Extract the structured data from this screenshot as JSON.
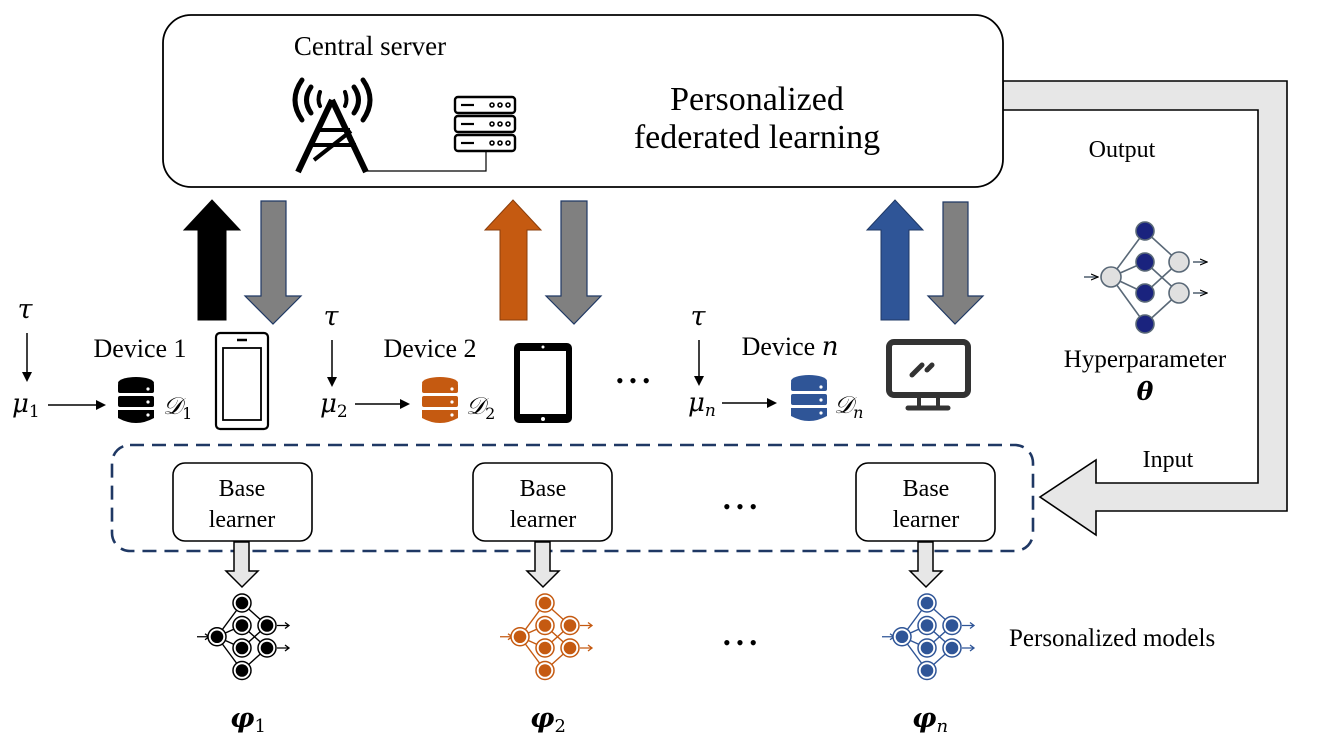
{
  "server": {
    "title": "Central server",
    "label_line1": "Personalized",
    "label_line2": "federated learning",
    "tower_icon": "radio-tower-icon",
    "rack_icon": "server-rack-icon"
  },
  "feedback": {
    "output_label": "Output",
    "input_label": "Input",
    "hyperparameter_label": "Hyperparameter",
    "hyperparameter_symbol": "θ",
    "nn_icon": "neural-network-icon"
  },
  "colors": {
    "device1": "#000000",
    "device2": "#c55a11",
    "devicen": "#2f5597",
    "download_arrow": "#808080",
    "dashed_border": "#1f3864",
    "feedback_arrow": "#e7e7e7",
    "hyper_node": "#1a237e"
  },
  "devices": [
    {
      "name": "Device 1",
      "tau": "τ",
      "mu": "μ",
      "mu_sub": "1",
      "data": "𝒟",
      "data_sub": "1",
      "device_icon": "smartphone-icon",
      "db_icon": "database-icon",
      "learner_l1": "Base",
      "learner_l2": "learner",
      "model": "φ",
      "model_sub": "1"
    },
    {
      "name": "Device 2",
      "tau": "τ",
      "mu": "μ",
      "mu_sub": "2",
      "data": "𝒟",
      "data_sub": "2",
      "device_icon": "tablet-icon",
      "db_icon": "database-icon",
      "learner_l1": "Base",
      "learner_l2": "learner",
      "model": "φ",
      "model_sub": "2"
    },
    {
      "name_prefix": "Device ",
      "name_var": "n",
      "tau": "τ",
      "mu": "μ",
      "mu_sub": "n",
      "data": "𝒟",
      "data_sub": "n",
      "device_icon": "monitor-icon",
      "db_icon": "database-icon",
      "learner_l1": "Base",
      "learner_l2": "learner",
      "model": "φ",
      "model_sub": "n"
    }
  ],
  "ellipsis": "• • •",
  "personalized_models_label": "Personalized models"
}
